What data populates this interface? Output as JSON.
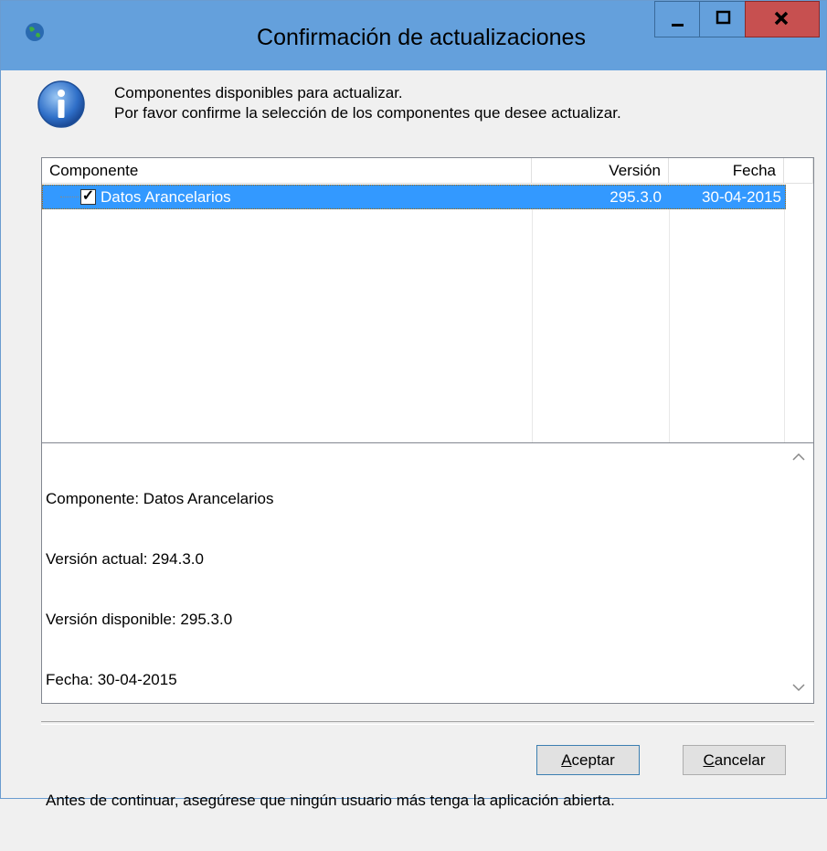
{
  "window": {
    "title": "Confirmación de actualizaciones",
    "controls": {
      "minimize": "—",
      "maximize": "□",
      "close": "X"
    }
  },
  "message": {
    "line1": "Componentes disponibles para actualizar.",
    "line2": "Por favor confirme la selección de los componentes que desee actualizar."
  },
  "table": {
    "headers": {
      "component": "Componente",
      "version": "Versión",
      "date": "Fecha"
    },
    "rows": [
      {
        "checked": true,
        "component": "Datos Arancelarios",
        "version": "295.3.0",
        "date": "30-04-2015"
      }
    ]
  },
  "detail": {
    "line1": "Componente: Datos Arancelarios",
    "line2": "Versión actual: 294.3.0",
    "line3": "Versión disponible: 295.3.0",
    "line4": "Fecha: 30-04-2015",
    "line5": "Antes de continuar, asegúrese que ningún usuario más tenga la aplicación abierta."
  },
  "buttons": {
    "accept_label": "Aceptar",
    "cancel_label": "Cancelar"
  },
  "icons": {
    "app": "globe-icon",
    "info": "info-icon",
    "scroll_up": "chevron-up-icon",
    "scroll_down": "chevron-down-icon"
  },
  "colors": {
    "titlebar": "#64a0dc",
    "close_button": "#c75050",
    "selection": "#3399ff"
  }
}
